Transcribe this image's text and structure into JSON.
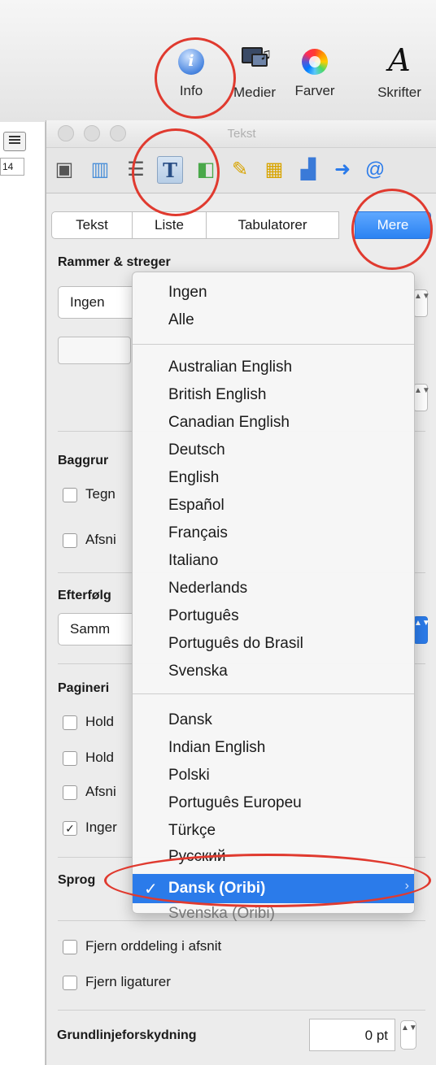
{
  "toolbar": {
    "info_label": "Info",
    "media_label": "Medier",
    "colors_label": "Farver",
    "fonts_label": "Skrifter"
  },
  "document": {
    "font_size": "14"
  },
  "inspector": {
    "title": "Tekst",
    "tabs": [
      "Tekst",
      "Liste",
      "Tabulatorer",
      "Mere"
    ],
    "selected_tab": "Mere"
  },
  "sections": {
    "borders": {
      "heading": "Rammer & streger",
      "popup": "Ingen"
    },
    "background": {
      "heading": "Baggrur",
      "char_check": "Tegn",
      "para_check": "Afsni"
    },
    "following": {
      "heading": "Efterfølg",
      "popup": "Samm"
    },
    "pagination": {
      "heading": "Pagineri",
      "items": [
        {
          "label": "Hold",
          "checked": false
        },
        {
          "label": "Hold",
          "checked": false
        },
        {
          "label": "Afsni",
          "checked": false
        },
        {
          "label": "Inger",
          "checked": true
        }
      ]
    },
    "language": {
      "heading": "Sprog"
    },
    "hyphen_check": "Fjern orddeling i afsnit",
    "ligature_check": "Fjern ligaturer",
    "baseline": {
      "label": "Grundlinjeforskydning",
      "value": "0 pt"
    }
  },
  "menu": {
    "group1": [
      "Ingen",
      "Alle"
    ],
    "group2": [
      "Australian English",
      "British English",
      "Canadian English",
      "Deutsch",
      "English",
      "Español",
      "Français",
      "Italiano",
      "Nederlands",
      "Português",
      "Português do Brasil",
      "Svenska"
    ],
    "group3": [
      "Dansk",
      "Indian English",
      "Polski",
      "Português Europeu",
      "Türkçe",
      "Русский"
    ],
    "selected": "Dansk (Oribi)",
    "after": "Svenska (Oribi)"
  },
  "colors": {
    "accent": "#2b7bea",
    "annotation": "#e03a2f"
  }
}
